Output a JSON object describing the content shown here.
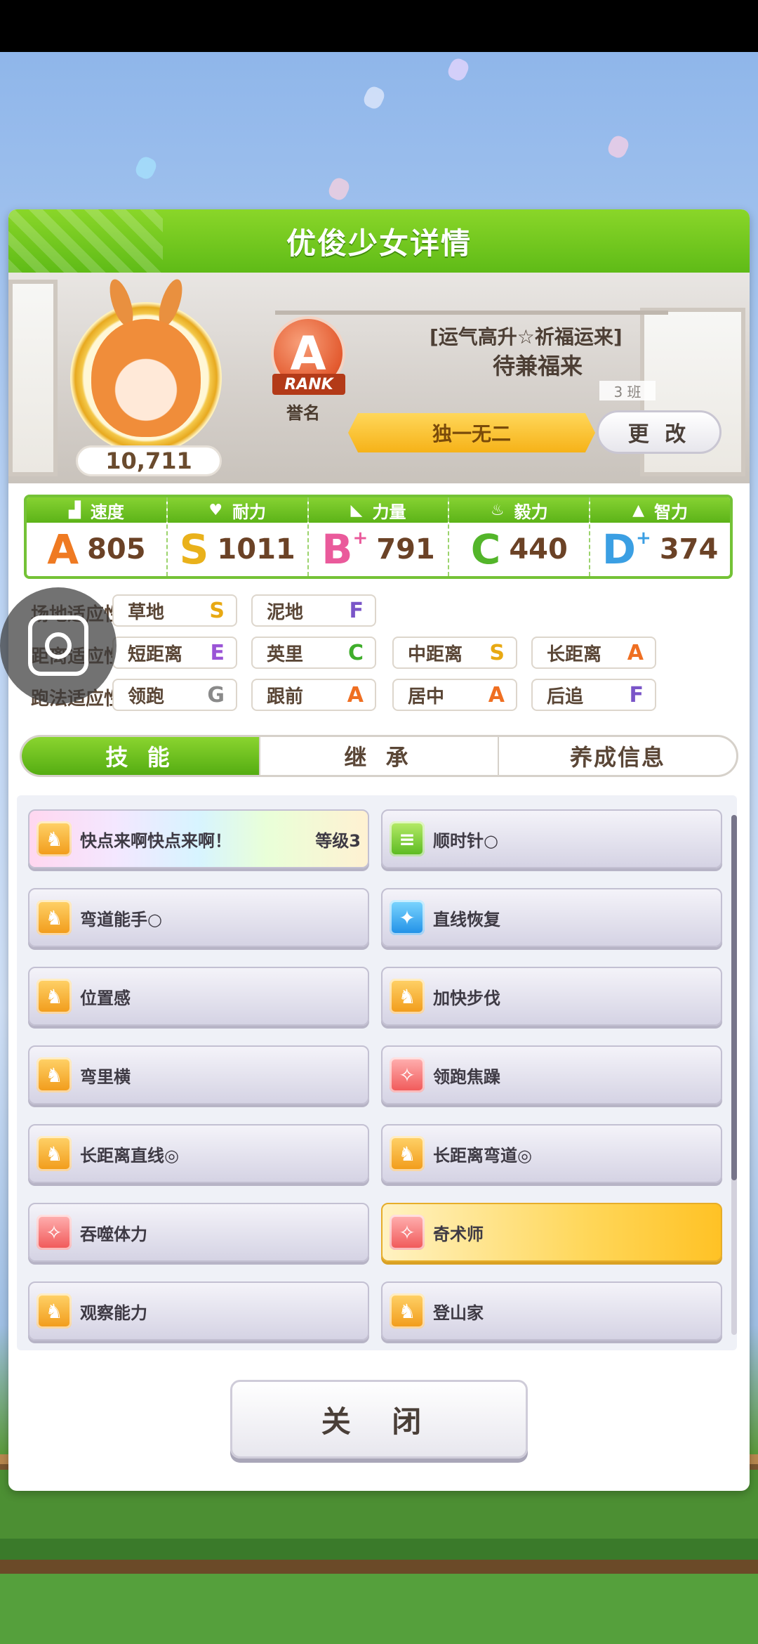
{
  "dialog": {
    "title": "优俊少女详情",
    "score": "10,711",
    "rank_letter": "A",
    "rank_ribbon": "RANK",
    "rank_caption": "誉名",
    "epithet": "[运气高升☆祈福运来]",
    "name": "待兼福来",
    "class_tag": "3 班",
    "title_banner": "独一无二",
    "change_label": "更 改",
    "close_label": "关 闭"
  },
  "stats": [
    {
      "label": "速度",
      "icon": "shoe-icon",
      "grade": "A",
      "plus": "",
      "value": "805",
      "color": "#ef7a22"
    },
    {
      "label": "耐力",
      "icon": "heart-icon",
      "grade": "S",
      "plus": "",
      "value": "1011",
      "color": "#e9b11b"
    },
    {
      "label": "力量",
      "icon": "muscle-icon",
      "grade": "B",
      "plus": "+",
      "value": "791",
      "color": "#ea5a9b"
    },
    {
      "label": "毅力",
      "icon": "flame-icon",
      "grade": "C",
      "plus": "",
      "value": "440",
      "color": "#53b52a"
    },
    {
      "label": "智力",
      "icon": "graduation-cap-icon",
      "grade": "D",
      "plus": "+",
      "value": "374",
      "color": "#3b9fe3"
    }
  ],
  "aptitude": {
    "track": {
      "label": "场地适应性",
      "items": [
        {
          "name": "草地",
          "grade": "S"
        },
        {
          "name": "泥地",
          "grade": "F"
        }
      ]
    },
    "distance": {
      "label": "距离适应性",
      "items": [
        {
          "name": "短距离",
          "grade": "E"
        },
        {
          "name": "英里",
          "grade": "C"
        },
        {
          "name": "中距离",
          "grade": "S"
        },
        {
          "name": "长距离",
          "grade": "A"
        }
      ]
    },
    "style": {
      "label": "跑法适应性",
      "items": [
        {
          "name": "领跑",
          "grade": "G"
        },
        {
          "name": "跟前",
          "grade": "A"
        },
        {
          "name": "居中",
          "grade": "A"
        },
        {
          "name": "后追",
          "grade": "F"
        }
      ]
    }
  },
  "grade_colors": {
    "S": "#e8a913",
    "A": "#ef6f22",
    "B": "#e8508f",
    "C": "#3fae2b",
    "D": "#2e92e0",
    "E": "#9a54d6",
    "F": "#7a55c8",
    "G": "#8a8a8a"
  },
  "tabs": [
    "技 能",
    "继 承",
    "养成信息"
  ],
  "skills": [
    {
      "name": "快点来啊快点来啊！",
      "level": "等级3",
      "icon": "orange",
      "style": "rainbow"
    },
    {
      "name": "顺时针○",
      "level": "",
      "icon": "green",
      "style": ""
    },
    {
      "name": "弯道能手○",
      "level": "",
      "icon": "orange",
      "style": ""
    },
    {
      "name": "直线恢复",
      "level": "",
      "icon": "blue",
      "style": ""
    },
    {
      "name": "位置感",
      "level": "",
      "icon": "orange",
      "style": ""
    },
    {
      "name": "加快步伐",
      "level": "",
      "icon": "orange",
      "style": ""
    },
    {
      "name": "弯里横",
      "level": "",
      "icon": "orange",
      "style": ""
    },
    {
      "name": "领跑焦躁",
      "level": "",
      "icon": "red",
      "style": ""
    },
    {
      "name": "长距离直线◎",
      "level": "",
      "icon": "orange",
      "style": ""
    },
    {
      "name": "长距离弯道◎",
      "level": "",
      "icon": "orange",
      "style": ""
    },
    {
      "name": "吞噬体力",
      "level": "",
      "icon": "red",
      "style": ""
    },
    {
      "name": "奇术师",
      "level": "",
      "icon": "red",
      "style": "gold"
    },
    {
      "name": "观察能力",
      "level": "",
      "icon": "orange",
      "style": ""
    },
    {
      "name": "登山家",
      "level": "",
      "icon": "orange",
      "style": ""
    }
  ]
}
